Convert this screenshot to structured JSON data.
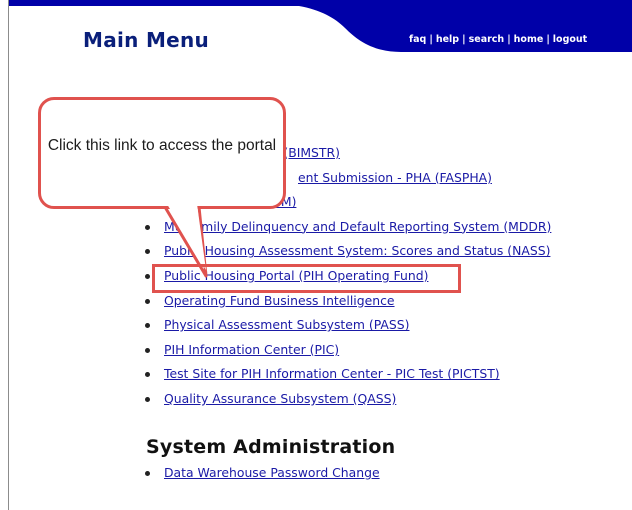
{
  "header": {
    "title": "Main Menu",
    "links": [
      "faq",
      "help",
      "search",
      "home",
      "logout"
    ],
    "separator": "|",
    "colors": {
      "band": "#0000a8",
      "title": "#0a1f7a"
    }
  },
  "menu_items": [
    "ce (BIMSTR)",
    "ent Submission - PHA (FASPHA)",
    "2M)",
    "amily Delinquency and Default Reporting System (MDDR)",
    "Public Housing Assessment System: Scores and Status (NASS)",
    "Public Housing Portal (PIH Operating Fund)",
    "Operating Fund Business Intelligence",
    "Physical Assessment Subsystem (PASS)",
    "PIH Information Center (PIC)",
    "Test Site for PIH Information Center - PIC Test (PICTST)",
    "Quality Assurance Subsystem (QASS)"
  ],
  "menu_item_prefix_visible": [
    "",
    "",
    "",
    "Mu",
    "Public",
    "",
    "",
    "",
    "",
    "",
    ""
  ],
  "system_admin": {
    "title": "System Administration",
    "items": [
      "Data Warehouse Password Change"
    ]
  },
  "annotation": {
    "callout_text": "Click this link to access the portal",
    "highlight_color": "#e0524e"
  }
}
